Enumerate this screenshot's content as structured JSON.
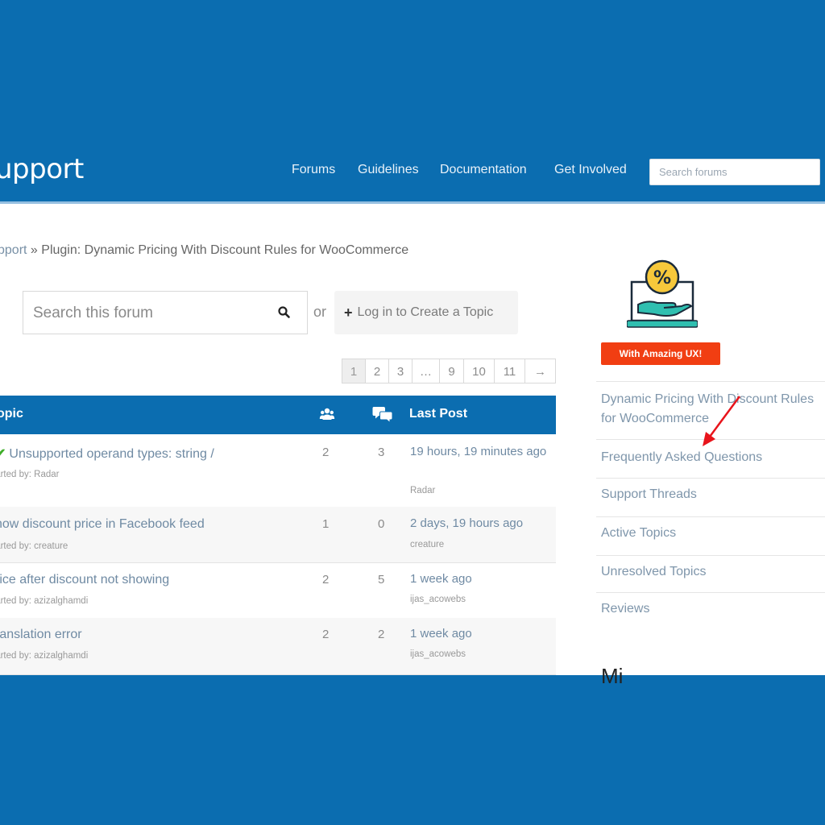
{
  "header": {
    "site_title": "upport",
    "nav": [
      "Forums",
      "Guidelines",
      "Documentation",
      "Get Involved"
    ],
    "search_placeholder": "Search forums"
  },
  "breadcrumb": {
    "link": "pport",
    "separator": " » ",
    "current": "Plugin: Dynamic Pricing With Discount Rules for WooCommerce"
  },
  "forum_search": {
    "placeholder": "Search this forum"
  },
  "or_text": "or",
  "create_topic": {
    "label": "Log in to Create a Topic"
  },
  "pagination": [
    "1",
    "2",
    "3",
    "…",
    "9",
    "10",
    "11",
    "→"
  ],
  "pagination_current": "1",
  "table": {
    "header_topic": "opic",
    "header_voices_icon": "users-icon",
    "header_posts_icon": "comments-icon",
    "header_last_post": "Last Post"
  },
  "topics": [
    {
      "title": "Unsupported operand types: string /",
      "resolved": true,
      "starter": "tarted by: Radar",
      "voices": "2",
      "posts": "3",
      "freshness": "19 hours, 19 minutes ago",
      "fresh_author": "Radar"
    },
    {
      "title": "how discount price in Facebook feed",
      "resolved": false,
      "starter": "tarted by: creature",
      "voices": "1",
      "posts": "0",
      "freshness": "2 days, 19 hours ago",
      "fresh_author": "creature"
    },
    {
      "title": "rice after discount not showing",
      "resolved": false,
      "starter": "tarted by: azizalghamdi",
      "voices": "2",
      "posts": "5",
      "freshness": "1 week ago",
      "fresh_author": "ijas_acowebs"
    },
    {
      "title": "ranslation error",
      "resolved": false,
      "starter": "tarted by: azizalghamdi",
      "voices": "2",
      "posts": "2",
      "freshness": "1 week ago",
      "fresh_author": "ijas_acowebs"
    }
  ],
  "sidebar": {
    "badge": "With Amazing UX!",
    "links": [
      "Dynamic Pricing With Discount Rules for WooCommerce",
      "Frequently Asked Questions",
      "Support Threads",
      "Active Topics",
      "Unresolved Topics",
      "Reviews"
    ],
    "partial_heading": "Mi"
  },
  "colors": {
    "brand_blue": "#0b6db0",
    "badge_red": "#f13e12",
    "annotation_red": "#e8141b",
    "resolved_green": "#3fae29"
  },
  "icons": {
    "search": "search-icon",
    "plus": "plus-icon",
    "plugin": "discount-hand-monitor-icon",
    "resolved": "checkmark-icon",
    "annotation": "red-arrow-icon"
  }
}
